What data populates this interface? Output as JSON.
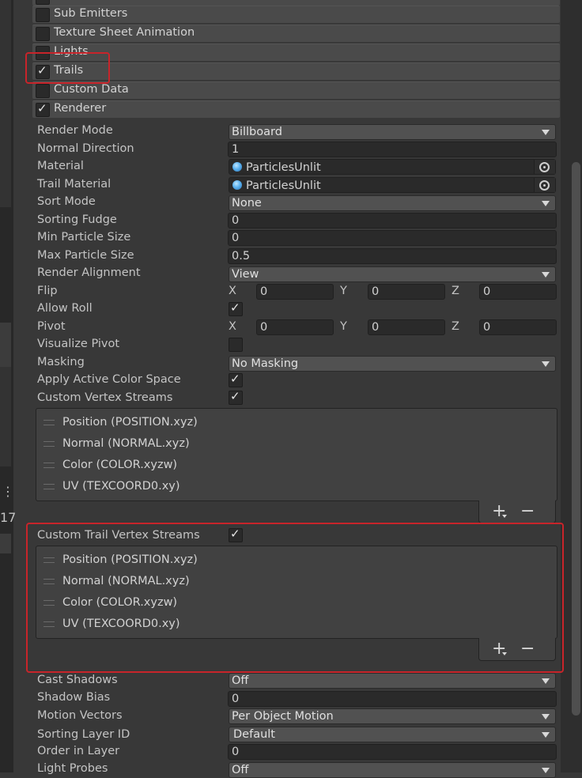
{
  "modules": [
    {
      "label": "Sub Emitters",
      "checked": false
    },
    {
      "label": "Texture Sheet Animation",
      "checked": false
    },
    {
      "label": "Lights",
      "checked": false
    },
    {
      "label": "Trails",
      "checked": true
    },
    {
      "label": "Custom Data",
      "checked": false
    },
    {
      "label": "Renderer",
      "checked": true
    }
  ],
  "left_panel": {
    "menu_glyph": "⋮",
    "number": "17"
  },
  "renderer": {
    "render_mode": {
      "label": "Render Mode",
      "value": "Billboard"
    },
    "normal_direction": {
      "label": "Normal Direction",
      "value": "1"
    },
    "material": {
      "label": "Material",
      "value": "ParticlesUnlit"
    },
    "trail_material": {
      "label": "Trail Material",
      "value": "ParticlesUnlit"
    },
    "sort_mode": {
      "label": "Sort Mode",
      "value": "None"
    },
    "sorting_fudge": {
      "label": "Sorting Fudge",
      "value": "0"
    },
    "min_particle_size": {
      "label": "Min Particle Size",
      "value": "0"
    },
    "max_particle_size": {
      "label": "Max Particle Size",
      "value": "0.5"
    },
    "render_alignment": {
      "label": "Render Alignment",
      "value": "View"
    },
    "flip": {
      "label": "Flip",
      "x": "0",
      "y": "0",
      "z": "0"
    },
    "allow_roll": {
      "label": "Allow Roll",
      "checked": true
    },
    "pivot": {
      "label": "Pivot",
      "x": "0",
      "y": "0",
      "z": "0"
    },
    "visualize_pivot": {
      "label": "Visualize Pivot",
      "checked": false
    },
    "masking": {
      "label": "Masking",
      "value": "No Masking"
    },
    "apply_active_color_space": {
      "label": "Apply Active Color Space",
      "checked": true
    },
    "custom_vertex_streams": {
      "label": "Custom Vertex Streams",
      "checked": true
    },
    "vertex_streams": [
      "Position (POSITION.xyz)",
      "Normal (NORMAL.xyz)",
      "Color (COLOR.xyzw)",
      "UV (TEXCOORD0.xy)"
    ],
    "custom_trail_vertex_streams": {
      "label": "Custom Trail Vertex Streams",
      "checked": true
    },
    "trail_vertex_streams": [
      "Position (POSITION.xyz)",
      "Normal (NORMAL.xyz)",
      "Color (COLOR.xyzw)",
      "UV (TEXCOORD0.xy)"
    ],
    "cast_shadows": {
      "label": "Cast Shadows",
      "value": "Off"
    },
    "shadow_bias": {
      "label": "Shadow Bias",
      "value": "0"
    },
    "motion_vectors": {
      "label": "Motion Vectors",
      "value": "Per Object Motion"
    },
    "sorting_layer_id": {
      "label": "Sorting Layer ID",
      "value": "Default"
    },
    "order_in_layer": {
      "label": "Order in Layer",
      "value": "0"
    },
    "light_probes": {
      "label": "Light Probes",
      "value": "Off"
    }
  },
  "axis_labels": {
    "x": "X",
    "y": "Y",
    "z": "Z"
  },
  "list_buttons": {
    "add": "+",
    "remove": "−"
  },
  "colors": {
    "highlight": "#c8242a",
    "background": "#383838",
    "field": "#2a2a2a"
  }
}
